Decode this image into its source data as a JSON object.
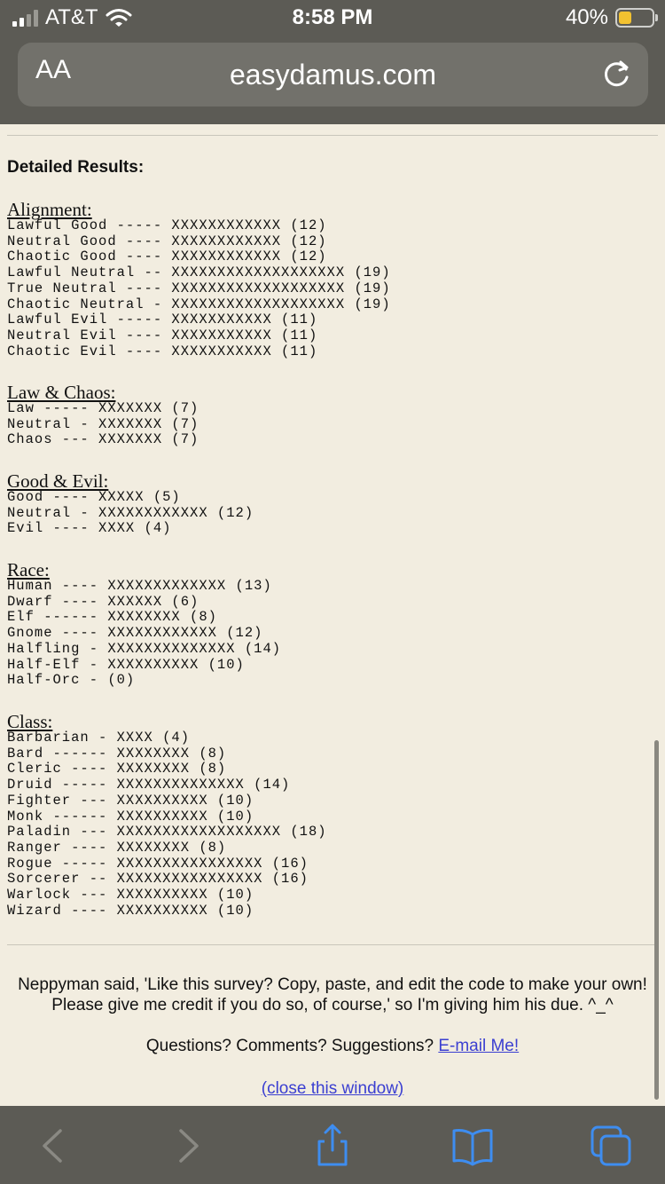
{
  "status": {
    "carrier": "AT&T",
    "time": "8:58 PM",
    "battery": "40%"
  },
  "browser": {
    "text_size_label": "AA",
    "url": "easydamus.com"
  },
  "results": {
    "heading": "Detailed Results:",
    "sections": [
      {
        "title": "Alignment:",
        "lines": [
          "Lawful Good ----- XXXXXXXXXXXX (12)",
          "Neutral Good ---- XXXXXXXXXXXX (12)",
          "Chaotic Good ---- XXXXXXXXXXXX (12)",
          "Lawful Neutral -- XXXXXXXXXXXXXXXXXXX (19)",
          "True Neutral ---- XXXXXXXXXXXXXXXXXXX (19)",
          "Chaotic Neutral - XXXXXXXXXXXXXXXXXXX (19)",
          "Lawful Evil ----- XXXXXXXXXXX (11)",
          "Neutral Evil ---- XXXXXXXXXXX (11)",
          "Chaotic Evil ---- XXXXXXXXXXX (11)"
        ]
      },
      {
        "title": "Law & Chaos:",
        "lines": [
          "Law ----- XXXXXXX (7)",
          "Neutral - XXXXXXX (7)",
          "Chaos --- XXXXXXX (7)"
        ]
      },
      {
        "title": "Good & Evil:",
        "lines": [
          "Good ---- XXXXX (5)",
          "Neutral - XXXXXXXXXXXX (12)",
          "Evil ---- XXXX (4)"
        ]
      },
      {
        "title": "Race:",
        "lines": [
          "Human ---- XXXXXXXXXXXXX (13)",
          "Dwarf ---- XXXXXX (6)",
          "Elf ------ XXXXXXXX (8)",
          "Gnome ---- XXXXXXXXXXXX (12)",
          "Halfling - XXXXXXXXXXXXXX (14)",
          "Half-Elf - XXXXXXXXXX (10)",
          "Half-Orc - (0)"
        ]
      },
      {
        "title": "Class:",
        "lines": [
          "Barbarian - XXXX (4)",
          "Bard ------ XXXXXXXX (8)",
          "Cleric ---- XXXXXXXX (8)",
          "Druid ----- XXXXXXXXXXXXXX (14)",
          "Fighter --- XXXXXXXXXX (10)",
          "Monk ------ XXXXXXXXXX (10)",
          "Paladin --- XXXXXXXXXXXXXXXXXX (18)",
          "Ranger ---- XXXXXXXX (8)",
          "Rogue ----- XXXXXXXXXXXXXXXX (16)",
          "Sorcerer -- XXXXXXXXXXXXXXXX (16)",
          "Warlock --- XXXXXXXXXX (10)",
          "Wizard ---- XXXXXXXXXX (10)"
        ]
      }
    ]
  },
  "footer": {
    "credit": "Neppyman said, 'Like this survey? Copy, paste, and edit the code to make your own! Please give me credit if you do so, of course,' so I'm giving him his due. ^_^",
    "questions": "Questions? Comments? Suggestions?",
    "email_link": "E-mail Me!",
    "close_link": "(close this window)"
  },
  "icons": [
    "wifi-icon",
    "signal-icon",
    "battery-icon",
    "reload-icon",
    "back-icon",
    "forward-icon",
    "share-icon",
    "bookmarks-icon",
    "tabs-icon"
  ]
}
